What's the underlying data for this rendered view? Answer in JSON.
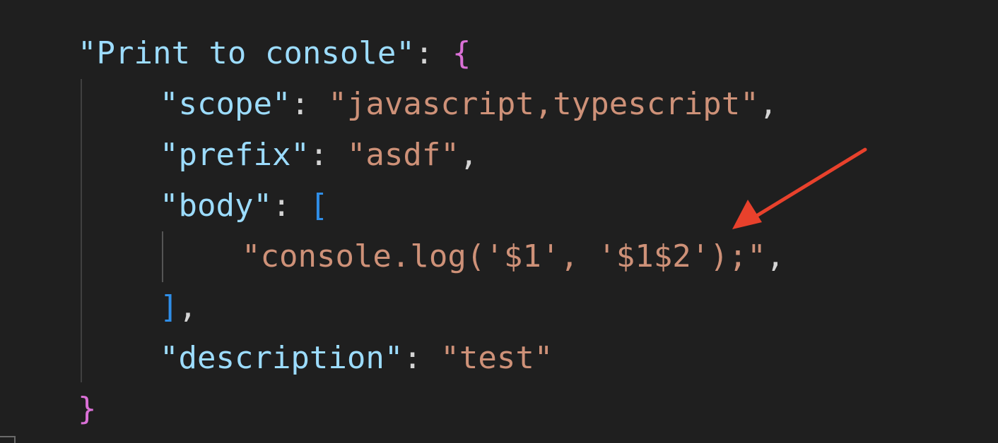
{
  "snippet": {
    "name_key": "\"Print to console\"",
    "name_colon": ": ",
    "open_brace": "{",
    "scope": {
      "key": "\"scope\"",
      "colon": ": ",
      "value": "\"javascript,typescript\"",
      "comma": ","
    },
    "prefix": {
      "key": "\"prefix\"",
      "colon": ": ",
      "value": "\"asdf\"",
      "comma": ","
    },
    "body": {
      "key": "\"body\"",
      "colon": ": ",
      "open_bracket": "[",
      "line": "\"console.log('$1', '$1$2');\"",
      "line_comma": ",",
      "close_bracket": "]",
      "close_comma": ","
    },
    "description": {
      "key": "\"description\"",
      "colon": ": ",
      "value": "\"test\""
    },
    "close_brace": "}"
  },
  "annotation": {
    "arrow_color": "#e8412c",
    "arrow_target": "'$1$2'"
  },
  "colors": {
    "background": "#1f1f1f",
    "key": "#9cdcfe",
    "string": "#ce9178",
    "brace": "#da70d6",
    "bracket": "#2f8ee8",
    "punctuation": "#d4d4d4"
  }
}
